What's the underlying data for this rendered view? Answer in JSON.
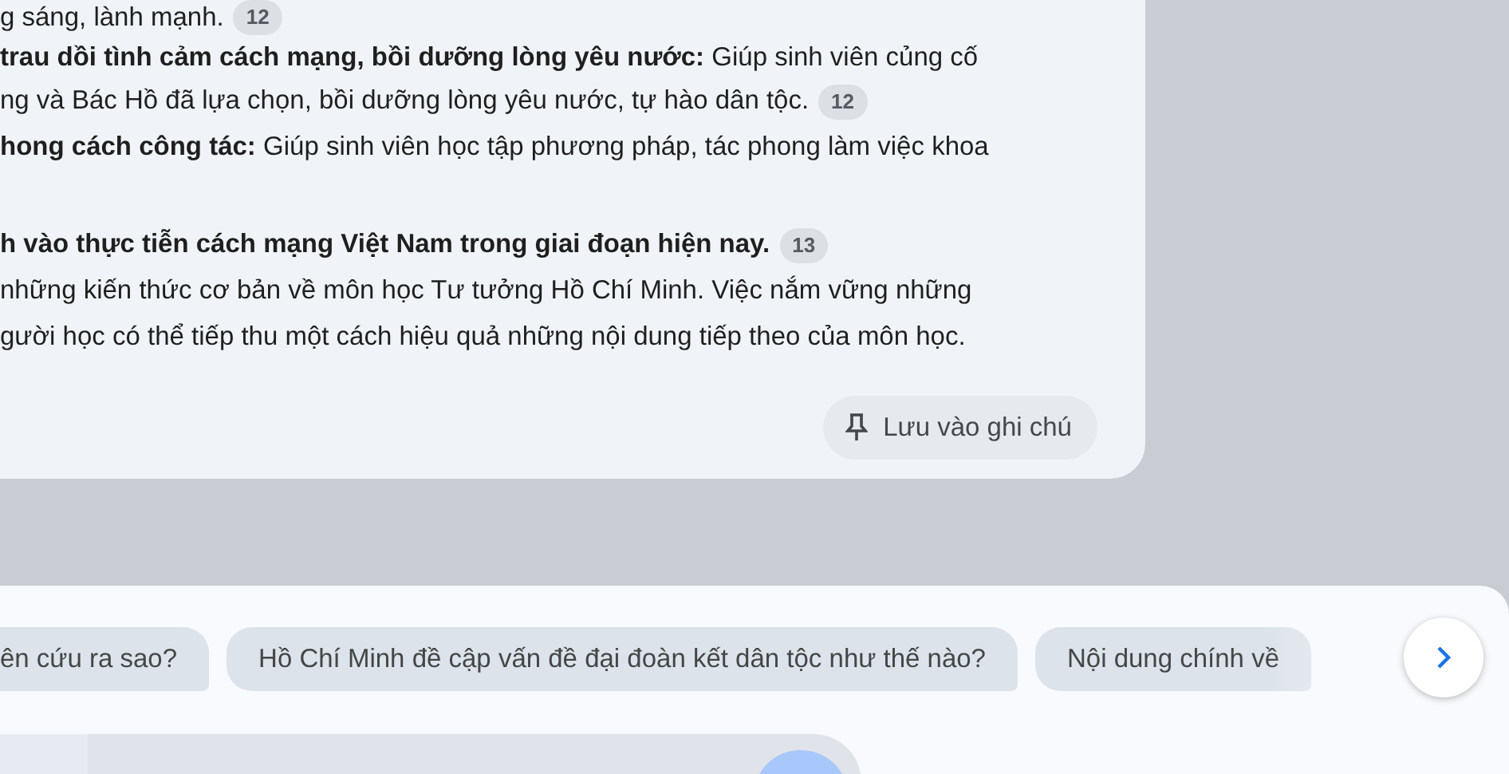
{
  "answer": {
    "paragraphs": [
      {
        "lines": [
          {
            "text": "g sáng, lành mạnh.",
            "citation": "12"
          }
        ]
      },
      {
        "lines": [
          {
            "text": "**trau dồi tình cảm cách mạng, bồi dưỡng lòng yêu nước:** Giúp sinh viên củng cố"
          },
          {
            "text": "ng và Bác Hồ đã lựa chọn, bồi dưỡng lòng yêu nước, tự hào dân tộc.",
            "citation": "12"
          }
        ]
      },
      {
        "lines": [
          {
            "text": "**hong cách công tác:** Giúp sinh viên học tập phương pháp, tác phong làm việc khoa"
          }
        ]
      },
      {
        "lines": [
          {
            "text": "**h vào thực tiễn cách mạng Việt Nam trong giai đoạn hiện nay.**",
            "citation": "13"
          },
          {
            "text": "những kiến thức cơ bản về môn học Tư tưởng Hồ Chí Minh. Việc nắm vững những"
          },
          {
            "text": "gười học có thể tiếp thu một cách hiệu quả những nội dung tiếp theo của môn học."
          }
        ]
      }
    ],
    "save_button": {
      "label": "Lưu vào ghi chú"
    }
  },
  "suggestions": [
    {
      "label": "ên cứu ra sao?"
    },
    {
      "label": "Hồ Chí Minh đề cập vấn đề đại đoàn kết dân tộc như thế nào?"
    },
    {
      "label": "Nội dung chính về"
    }
  ]
}
